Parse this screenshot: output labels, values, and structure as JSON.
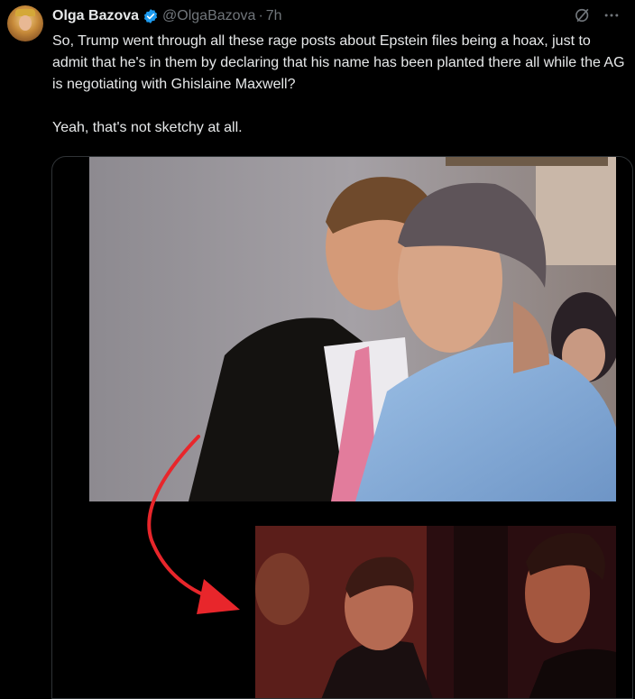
{
  "tweet": {
    "author_name": "Olga Bazova",
    "handle": "@OlgaBazova",
    "separator": "·",
    "time": "7h",
    "paragraphs": [
      "So, Trump went through all these rage posts about Epstein files being a hoax, just to admit that he's in them by declaring that his name has been planted there all while the AG is negotiating with Ghislaine Maxwell?",
      "Yeah, that's not sketchy at all."
    ]
  },
  "icons": {
    "verified": "verified-badge-icon",
    "grok": "grok-icon",
    "more": "more-icon"
  },
  "colors": {
    "background": "#000000",
    "text": "#e7e9ea",
    "secondary": "#71767b",
    "verified": "#1d9bf0",
    "arrow": "#e8262b"
  }
}
